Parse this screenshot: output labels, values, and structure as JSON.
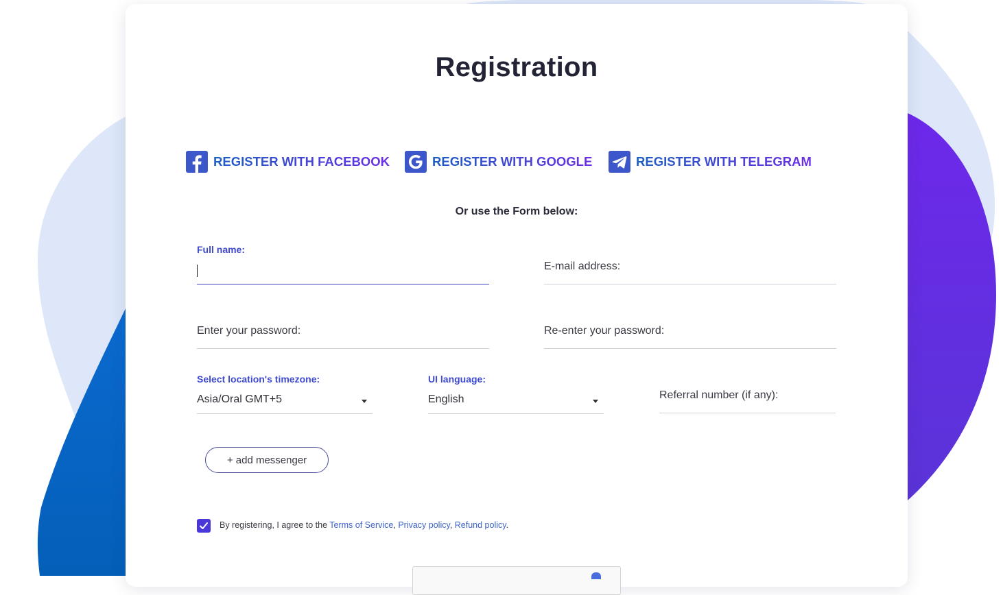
{
  "page": {
    "title": "Registration",
    "or_text": "Or use the Form below:"
  },
  "social": {
    "facebook": {
      "label": "REGISTER WITH FACEBOOK",
      "icon": "facebook-icon"
    },
    "google": {
      "label": "REGISTER WITH GOOGLE",
      "icon": "google-icon"
    },
    "telegram": {
      "label": "REGISTER WITH TELEGRAM",
      "icon": "telegram-icon"
    }
  },
  "form": {
    "full_name": {
      "label": "Full name:",
      "value": ""
    },
    "email": {
      "label": "E-mail address:",
      "value": ""
    },
    "password": {
      "label": "Enter your password:",
      "value": ""
    },
    "password_repeat": {
      "label": "Re-enter your password:",
      "value": ""
    },
    "timezone": {
      "label": "Select location's timezone:",
      "value": "Asia/Oral GMT+5"
    },
    "language": {
      "label": "UI language:",
      "value": "English"
    },
    "referral": {
      "label": "Referral number (if any):",
      "value": ""
    },
    "add_messenger": "+ add messenger",
    "agree": {
      "checked": true,
      "prefix": "By registering, I agree to the ",
      "terms": "Terms of Service",
      "sep1": ", ",
      "privacy": "Privacy policy",
      "sep2": ", ",
      "refund": "Refund policy",
      "suffix": "."
    }
  },
  "colors": {
    "accent": "#3e4ad0",
    "gradient_start": "#1c5fc4",
    "gradient_end": "#6b2de6",
    "blob_light": "#dde7f9",
    "blob_blue": "#0266c4",
    "blob_purple": "#6a2ae8"
  }
}
